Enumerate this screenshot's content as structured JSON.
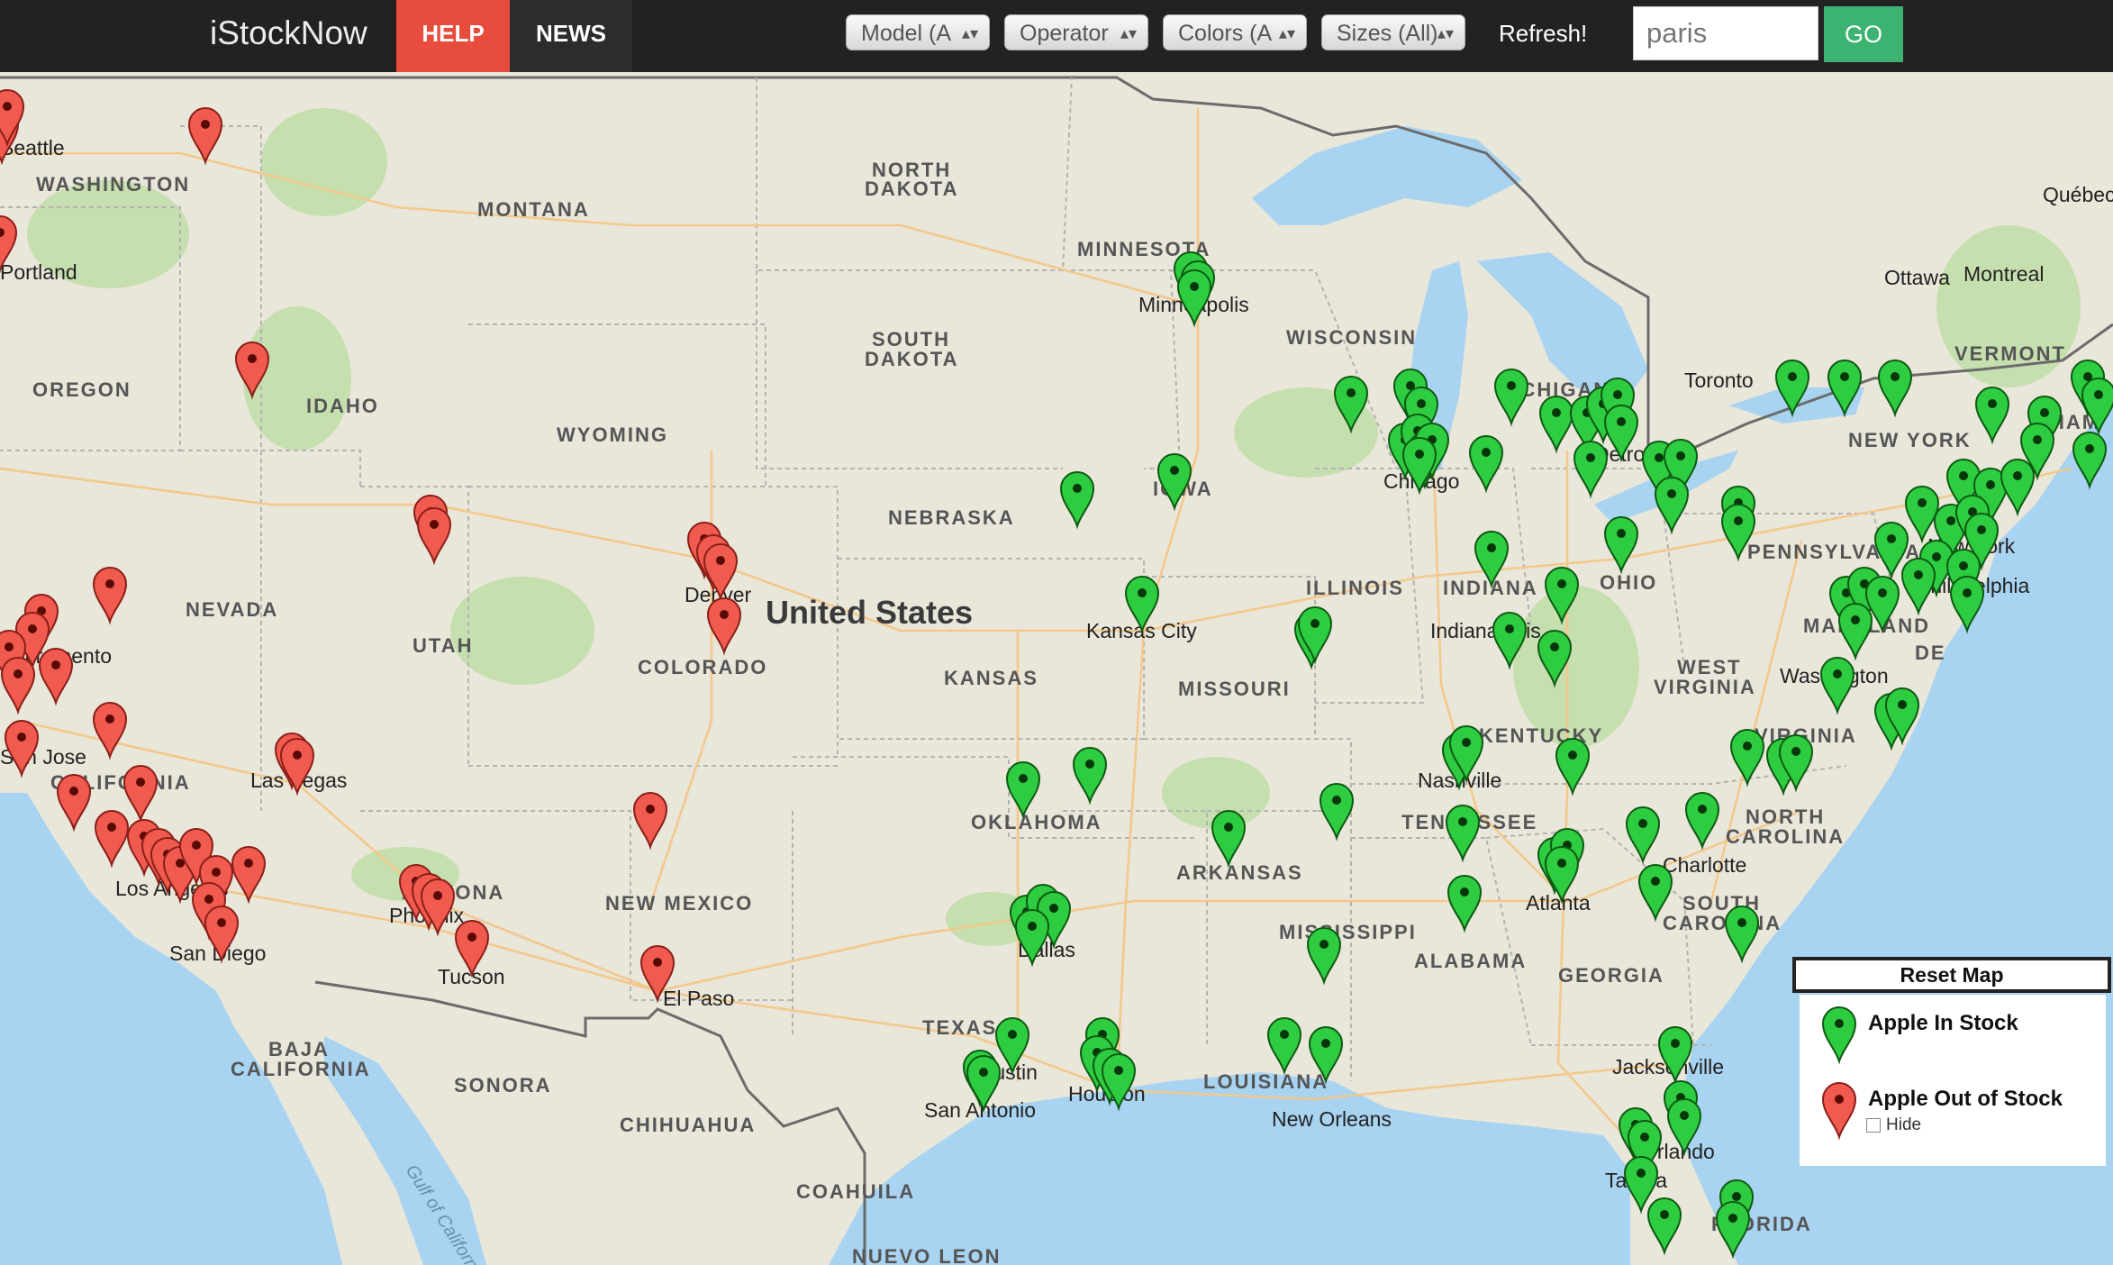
{
  "header": {
    "brand": "iStockNow",
    "nav": {
      "help": "HELP",
      "news": "NEWS"
    },
    "filters": [
      {
        "key": "model",
        "label": "Model (A"
      },
      {
        "key": "operator",
        "label": "Operator"
      },
      {
        "key": "colors",
        "label": "Colors (A"
      },
      {
        "key": "sizes",
        "label": "Sizes (All)"
      }
    ],
    "refresh": "Refresh!",
    "search_value": "paris",
    "go": "GO"
  },
  "map": {
    "country_label": "United States",
    "regions": [
      "WASHINGTON",
      "MONTANA",
      "NORTH DAKOTA",
      "MINNESOTA",
      "OREGON",
      "IDAHO",
      "SOUTH DAKOTA",
      "WISCONSIN",
      "MICHIGAN",
      "WYOMING",
      "NEBRASKA",
      "IOWA",
      "NEVADA",
      "UTAH",
      "COLORADO",
      "ILLINOIS",
      "INDIANA",
      "OHIO",
      "PENNSYLVANIA",
      "KANSAS",
      "MISSOURI",
      "WEST VIRGINIA",
      "KENTUCKY",
      "VIRGINIA",
      "CALIFORNIA",
      "OKLAHOMA",
      "TENNESSEE",
      "NORTH CAROLINA",
      "ARKANSAS",
      "NEW MEXICO",
      "ARIZONA",
      "SOUTH CAROLINA",
      "MISSISSIPPI",
      "ALABAMA",
      "GEORGIA",
      "TEXAS",
      "LOUISIANA",
      "BAJA CALIFORNIA",
      "SONORA",
      "CHIHUAHUA",
      "COAHUILA",
      "NUEVO LEON",
      "VERMONT",
      "NEW YORK",
      "MARYLAND",
      "DE",
      "FLORIDA",
      "HAM"
    ],
    "cities": [
      "Seattle",
      "Portland",
      "Sacramento",
      "San Jose",
      "Las Vegas",
      "Los Angeles",
      "San Diego",
      "Phoenix",
      "Tucson",
      "El Paso",
      "Denver",
      "Minneapolis",
      "Kansas City",
      "Chicago",
      "Detroit",
      "Indianapolis",
      "Nashville",
      "Atlanta",
      "Charlotte",
      "Washington",
      "Dallas",
      "Austin",
      "San Antonio",
      "Houston",
      "New Orleans",
      "Jacksonville",
      "Orlando",
      "Tampa",
      "Toronto",
      "Ottawa",
      "Montreal",
      "Québec",
      "New York",
      "Philadelphia"
    ],
    "water_labels": [
      "Gulf of California"
    ],
    "legend": {
      "reset": "Reset Map",
      "in_stock": "Apple In Stock",
      "out_of_stock": "Apple Out of Stock",
      "hide": "Hide",
      "in_color": "#2ecc40",
      "out_color": "#f05a4f"
    }
  }
}
